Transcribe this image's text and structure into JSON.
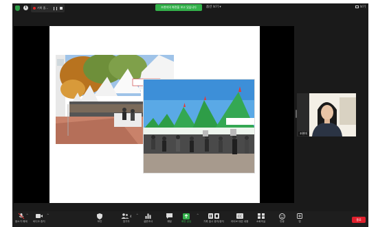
{
  "topbar": {
    "recording_label": "기록 중...",
    "share_banner": "조현미의 화면을 보고 있습니다",
    "view_options": "옵션 보기",
    "fullscreen_label": "보기"
  },
  "participant": {
    "name": "조현미"
  },
  "toolbar": {
    "items": [
      {
        "label": "음소거 해제",
        "icon": "mic-muted-icon"
      },
      {
        "label": "비디오 중지",
        "icon": "video-icon"
      },
      {
        "label": "보안",
        "icon": "shield-icon"
      },
      {
        "label": "참가자",
        "icon": "participants-icon",
        "count": "4"
      },
      {
        "label": "설문조사",
        "icon": "poll-icon"
      },
      {
        "label": "채팅",
        "icon": "chat-icon"
      },
      {
        "label": "화면 공유",
        "icon": "share-screen-icon"
      },
      {
        "label": "기록 일시 중지/중지",
        "icon": "record-pause-icon"
      },
      {
        "label": "라이브 대본 내용",
        "icon": "cc-icon"
      },
      {
        "label": "소회의실",
        "icon": "breakout-icon"
      },
      {
        "label": "반응",
        "icon": "reactions-icon"
      },
      {
        "label": "앱",
        "icon": "apps-icon"
      }
    ],
    "end_label": "종료"
  },
  "colors": {
    "share_green": "#34b24b",
    "end_red": "#e0202d",
    "toolbar_bg": "#1e1e1e"
  }
}
